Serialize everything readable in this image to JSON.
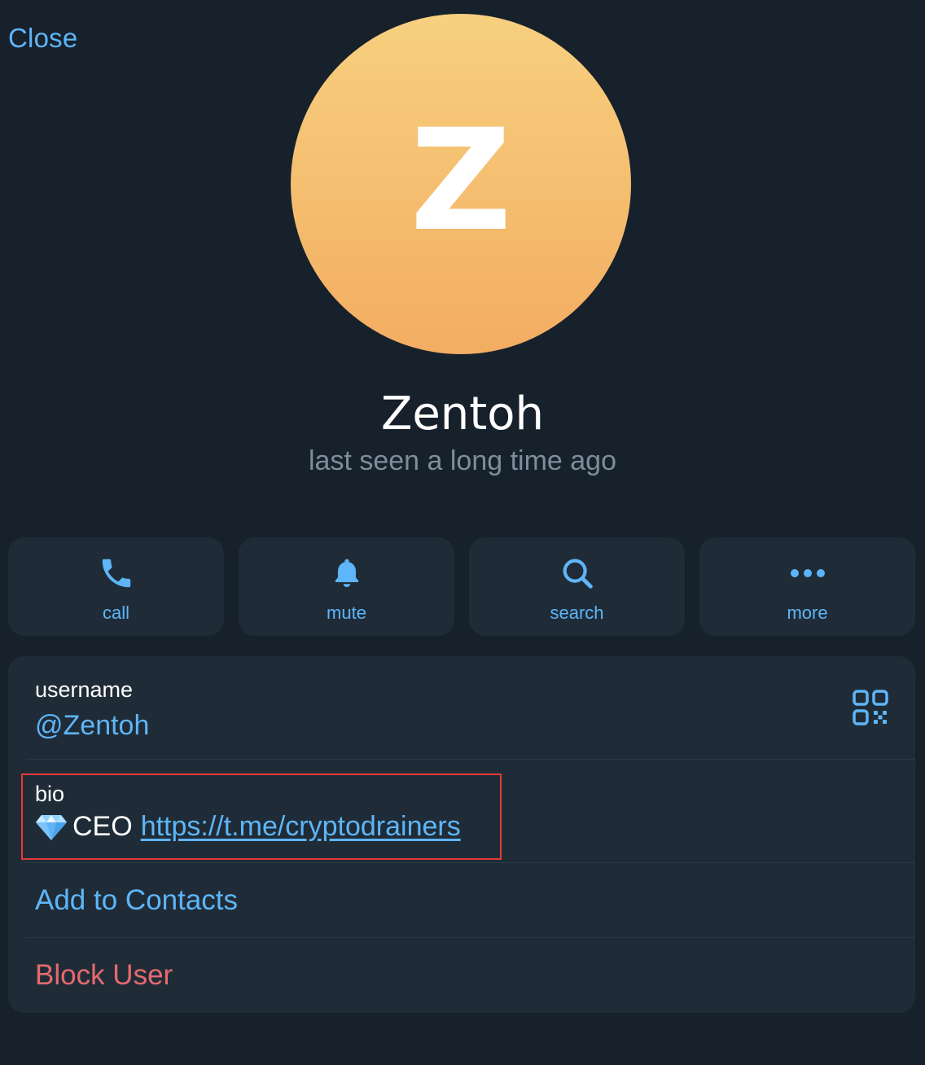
{
  "header": {
    "close_label": "Close"
  },
  "profile": {
    "avatar_letter": "Z",
    "avatar_gradient": [
      "#f7d07f",
      "#f3ad62"
    ],
    "name": "Zentoh",
    "status": "last seen a long time ago"
  },
  "actions": [
    {
      "icon": "phone-icon",
      "label": "call"
    },
    {
      "icon": "bell-icon",
      "label": "mute"
    },
    {
      "icon": "search-icon",
      "label": "search"
    },
    {
      "icon": "more-dots-icon",
      "label": "more"
    }
  ],
  "info": {
    "username_label": "username",
    "username_value": "@Zentoh",
    "qr_icon": "qr-code-icon",
    "bio_label": "bio",
    "bio_emoji": "diamond-icon",
    "bio_text": "CEO",
    "bio_link": "https://t.me/cryptodrainers",
    "highlight_color": "#e53935"
  },
  "menu": {
    "add_contacts": "Add to Contacts",
    "block_user": "Block User"
  },
  "colors": {
    "background": "#17212b",
    "card": "#1f2c38",
    "accent": "#5eb5f7",
    "danger": "#e56a6d",
    "muted": "#7f8d9b"
  }
}
